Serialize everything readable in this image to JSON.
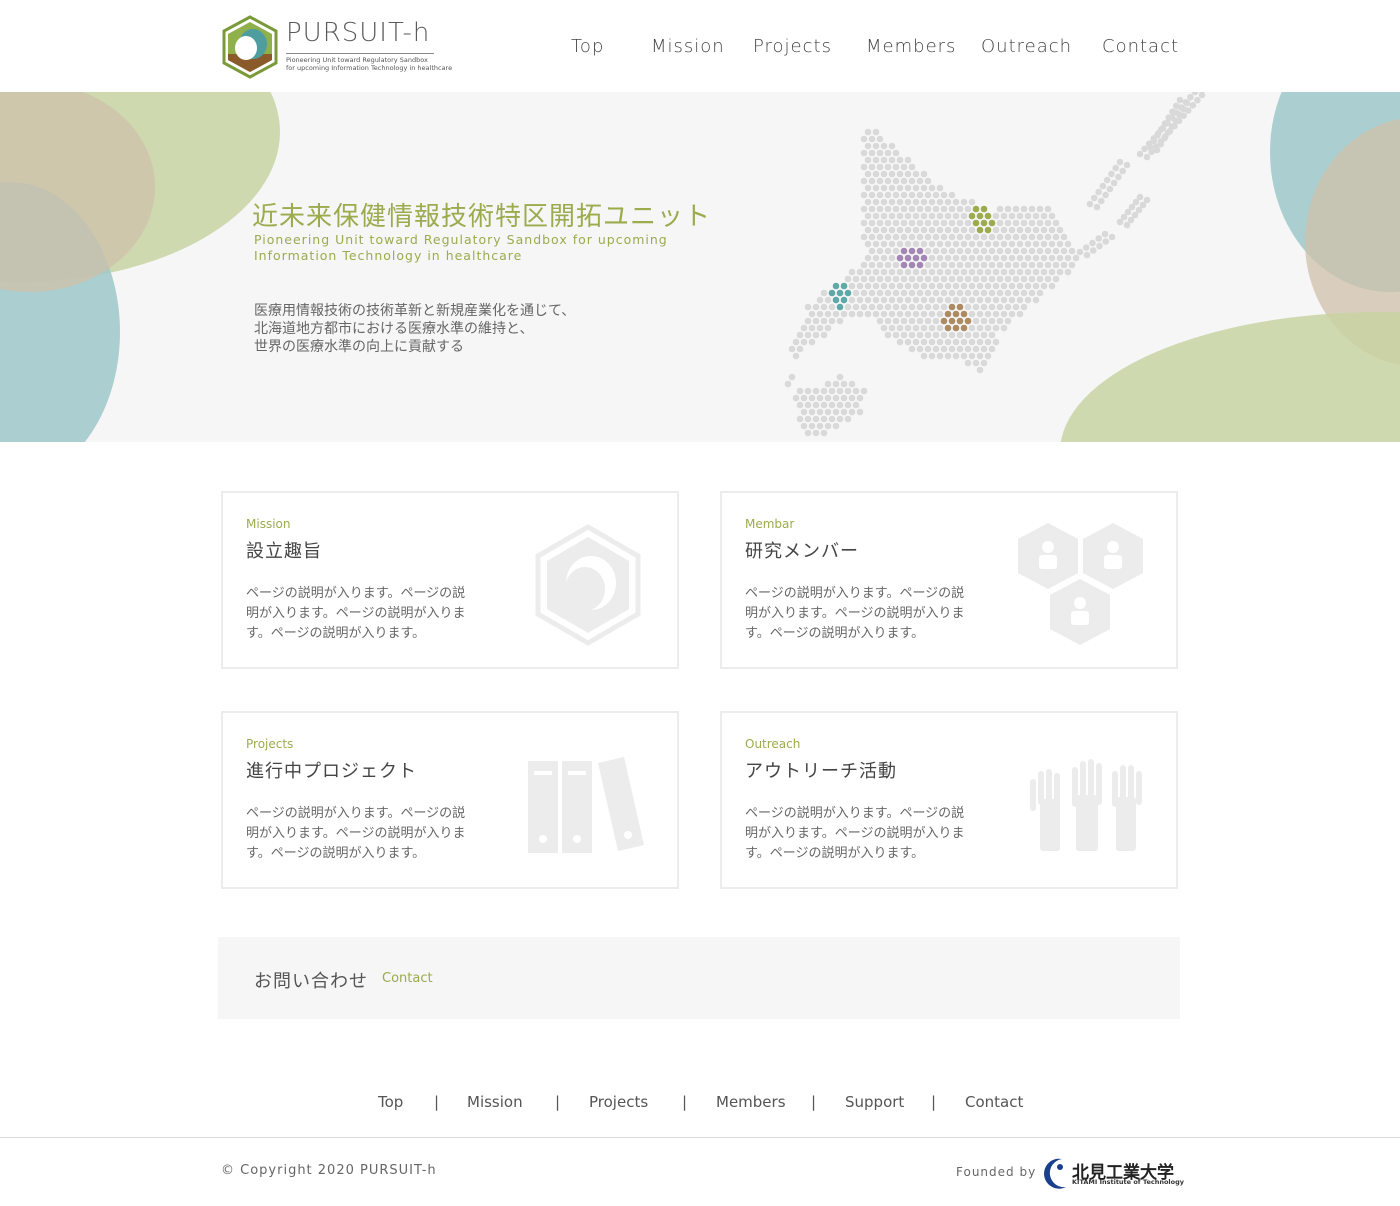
{
  "brand": {
    "name": "PURSUIT-h",
    "sub_line1": "Pioneering Unit toward Regulatory Sandbox",
    "sub_line2": "for upcoming Information Technology in healthcare"
  },
  "nav": [
    "Top",
    "Mission",
    "Projects",
    "Members",
    "Outreach",
    "Contact"
  ],
  "hero": {
    "title": "近未来保健情報技術特区開拓ユニット",
    "subtitle": "Pioneering Unit toward Regulatory Sandbox for upcoming Information Technology in healthcare",
    "body": [
      "医療用情報技術の技術革新と新規産業化を通じて、",
      "北海道地方都市における医療水準の維持と、",
      "世界の医療水準の向上に貢献する"
    ]
  },
  "cards": [
    {
      "en": "Mission",
      "title": "設立趣旨",
      "desc": "ページの説明が入ります。ページの説明が入ります。ページの説明が入ります。ページの説明が入ります。",
      "icon": "acorn-hexagon-icon"
    },
    {
      "en": "Membar",
      "title": "研究メンバー",
      "desc": "ページの説明が入ります。ページの説明が入ります。ページの説明が入ります。ページの説明が入ります。",
      "icon": "members-hexagon-icon"
    },
    {
      "en": "Projects",
      "title": "進行中プロジェクト",
      "desc": "ページの説明が入ります。ページの説明が入ります。ページの説明が入ります。ページの説明が入ります。",
      "icon": "binders-icon"
    },
    {
      "en": "Outreach",
      "title": "アウトリーチ活動",
      "desc": "ページの説明が入ります。ページの説明が入ります。ページの説明が入ります。ページの説明が入ります。",
      "icon": "raised-hands-icon"
    }
  ],
  "contact": {
    "jp": "お問い合わせ",
    "en": "Contact"
  },
  "footer": {
    "nav": [
      "Top",
      "Mission",
      "Projects",
      "Members",
      "Support",
      "Contact"
    ],
    "copyright": "© Copyright 2020 PURSUIT-h",
    "founded_by": "Founded by",
    "university_jp": "北見工業大学",
    "university_en": "KITAMI Institute of Technology"
  },
  "colors": {
    "accent_green": "#9bab4e",
    "blob_green": "#c8d3a2",
    "blob_teal": "#9ec8c9",
    "blob_tan": "#cfc0a9",
    "map_gray": "#d9d9d9",
    "map_purple": "#a486b4",
    "map_teal": "#5fa8a8",
    "map_brown": "#ad8a62"
  }
}
